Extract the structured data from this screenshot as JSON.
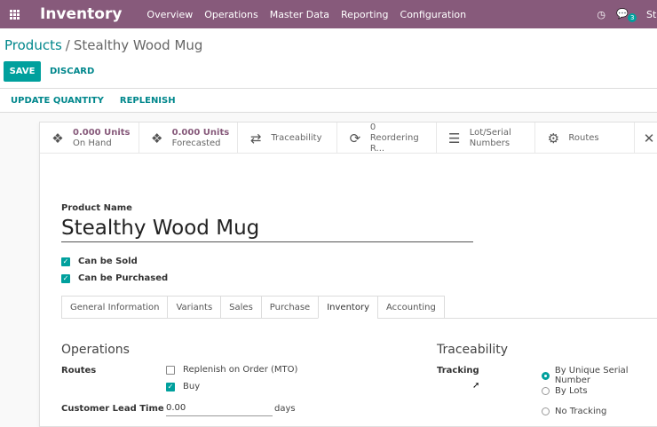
{
  "navbar": {
    "app_title": "Inventory",
    "menu": [
      "Overview",
      "Operations",
      "Master Data",
      "Reporting",
      "Configuration"
    ],
    "chat_badge": "3",
    "user_initial": "St"
  },
  "breadcrumb": {
    "parent": "Products",
    "separator": "/",
    "current": "Stealthy Wood Mug"
  },
  "actions": {
    "save": "SAVE",
    "discard": "DISCARD"
  },
  "header_buttons": [
    "UPDATE QUANTITY",
    "REPLENISH"
  ],
  "smart_buttons": [
    {
      "line1": "0.000 Units",
      "line2": "On Hand",
      "icon": "cubes-icon"
    },
    {
      "line1": "0.000 Units",
      "line2": "Forecasted",
      "icon": "cubes-icon"
    },
    {
      "line1": "",
      "line2": "Traceability",
      "icon": "exchange-icon"
    },
    {
      "line1": "0",
      "line2": "Reordering R...",
      "icon": "refresh-icon"
    },
    {
      "line1": "Lot/Serial",
      "line2": "Numbers",
      "icon": "bars-icon"
    },
    {
      "line1": "",
      "line2": "Routes",
      "icon": "cogs-icon"
    }
  ],
  "product": {
    "name_label": "Product Name",
    "name": "Stealthy Wood Mug",
    "can_be_sold": "Can be Sold",
    "can_be_purchased": "Can be Purchased"
  },
  "tabs": [
    "General Information",
    "Variants",
    "Sales",
    "Purchase",
    "Inventory",
    "Accounting"
  ],
  "active_tab": "Inventory",
  "operations": {
    "title": "Operations",
    "routes_label": "Routes",
    "route_mto": "Replenish on Order (MTO)",
    "route_buy": "Buy",
    "lead_time_label": "Customer Lead Time",
    "lead_time_value": "0.00",
    "lead_time_unit": "days"
  },
  "traceability": {
    "title": "Traceability",
    "tracking_label": "Tracking",
    "options": [
      "By Unique Serial Number",
      "By Lots",
      "No Tracking"
    ],
    "selected": "By Unique Serial Number"
  },
  "colors": {
    "navbar": "#875a7b",
    "primary": "#00a09d",
    "link": "#00878c"
  }
}
